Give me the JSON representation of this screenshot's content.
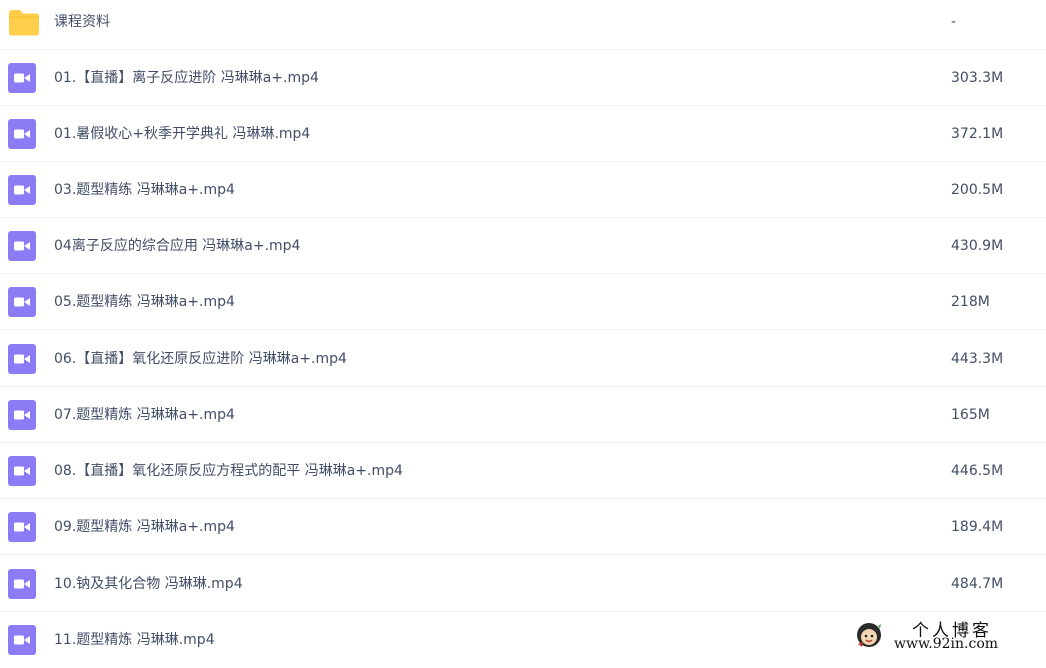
{
  "colors": {
    "folder_icon": "#ffcf4b",
    "video_icon": "#8b7cf6",
    "text": "#424e67",
    "divider": "#f1f2f5"
  },
  "files": [
    {
      "icon": "folder-icon",
      "name": "课程资料",
      "size": "-"
    },
    {
      "icon": "video-file-icon",
      "name": "01.【直播】离子反应进阶 冯琳琳a+.mp4",
      "size": "303.3M"
    },
    {
      "icon": "video-file-icon",
      "name": "01.暑假收心+秋季开学典礼 冯琳琳.mp4",
      "size": "372.1M"
    },
    {
      "icon": "video-file-icon",
      "name": "03.题型精练 冯琳琳a+.mp4",
      "size": "200.5M"
    },
    {
      "icon": "video-file-icon",
      "name": "04离子反应的综合应用 冯琳琳a+.mp4",
      "size": "430.9M"
    },
    {
      "icon": "video-file-icon",
      "name": "05.题型精练 冯琳琳a+.mp4",
      "size": "218M"
    },
    {
      "icon": "video-file-icon",
      "name": "06.【直播】氧化还原反应进阶 冯琳琳a+.mp4",
      "size": "443.3M"
    },
    {
      "icon": "video-file-icon",
      "name": "07.题型精炼 冯琳琳a+.mp4",
      "size": "165M"
    },
    {
      "icon": "video-file-icon",
      "name": "08.【直播】氧化还原反应方程式的配平 冯琳琳a+.mp4",
      "size": "446.5M"
    },
    {
      "icon": "video-file-icon",
      "name": "09.题型精炼 冯琳琳a+.mp4",
      "size": "189.4M"
    },
    {
      "icon": "video-file-icon",
      "name": "10.钠及其化合物 冯琳琳.mp4",
      "size": "484.7M"
    },
    {
      "icon": "video-file-icon",
      "name": "11.题型精炼 冯琳琳.mp4",
      "size": ""
    }
  ],
  "watermark": {
    "title": "个人博客",
    "url": "www.92in.com"
  }
}
